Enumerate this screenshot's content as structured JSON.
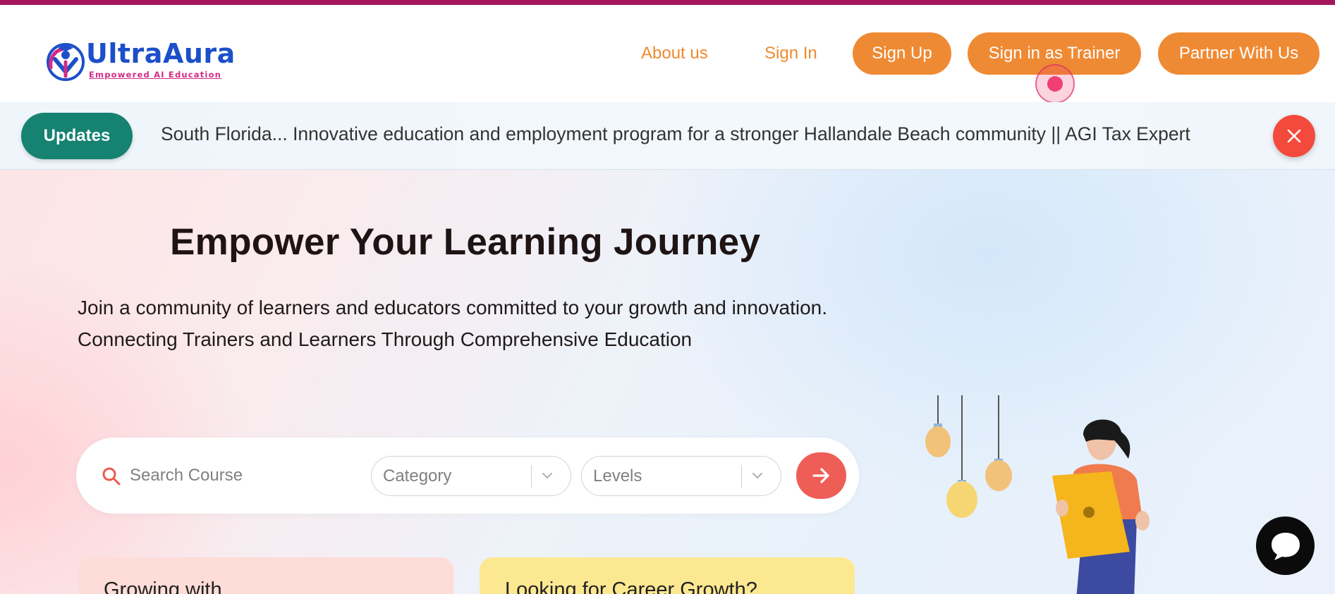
{
  "header": {
    "logo": {
      "brand_prefix": "Ultra",
      "brand_suffix": "Aura",
      "tagline": "Empowered AI Education"
    },
    "nav": {
      "about": "About us",
      "sign_in": "Sign In",
      "sign_up": "Sign Up",
      "sign_in_trainer": "Sign in as Trainer",
      "partner": "Partner With Us"
    }
  },
  "updates": {
    "badge": "Updates",
    "ticker": "South Florida... Innovative education and employment program for a stronger Hallandale Beach community || AGI Tax Expert"
  },
  "hero": {
    "title": "Empower Your Learning Journey",
    "description": "Join a community of learners and educators committed to your growth and innovation. Connecting Trainers and Learners Through Comprehensive Education",
    "search": {
      "placeholder": "Search Course",
      "category": "Category",
      "levels": "Levels"
    },
    "cards": [
      {
        "title": "Growing with"
      },
      {
        "title": "Looking for Career Growth?"
      }
    ]
  },
  "colors": {
    "top_strip": "#a3175a",
    "accent_orange": "#ef8a34",
    "updates_green": "#168272",
    "close_red": "#f44a3d",
    "go_red": "#ef5d57",
    "brand_blue": "#1c4fc9",
    "brand_pink": "#d32a86"
  },
  "icons": {
    "logo": "graduate-logo-icon",
    "close": "close-icon",
    "search": "search-icon",
    "chevron": "chevron-down-icon",
    "go": "arrow-right-icon",
    "chat": "chat-bubble-icon"
  }
}
